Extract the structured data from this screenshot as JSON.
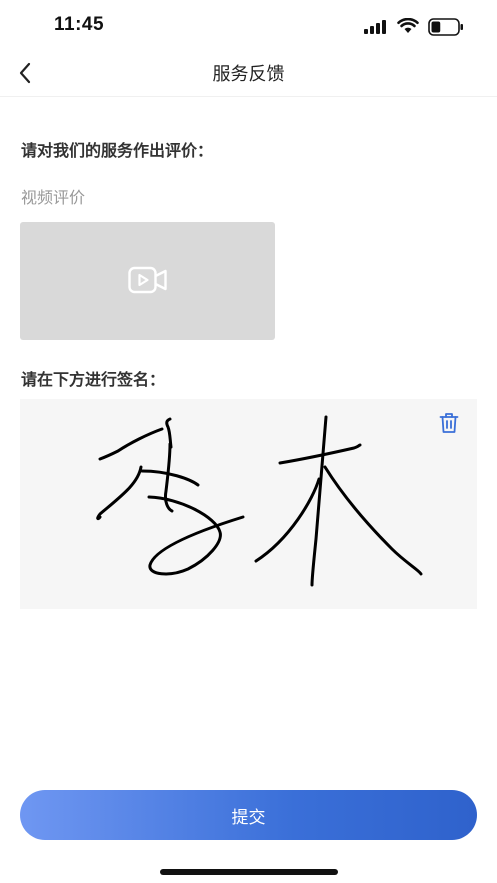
{
  "status_bar": {
    "time": "11:45",
    "battery_level": 0.35
  },
  "nav": {
    "title": "服务反馈"
  },
  "evaluation": {
    "heading": "请对我们的服务作出评价：",
    "video_label": "视频评价"
  },
  "signature": {
    "heading": "请在下方进行签名："
  },
  "submit": {
    "label": "提交"
  },
  "colors": {
    "accent_start": "#6f97f2",
    "accent_end": "#2f62cc",
    "trash_icon": "#3a6fd8"
  },
  "icons": [
    "back-chevron-icon",
    "video-camera-icon",
    "trash-icon",
    "signal-icon",
    "wifi-icon",
    "battery-icon"
  ]
}
